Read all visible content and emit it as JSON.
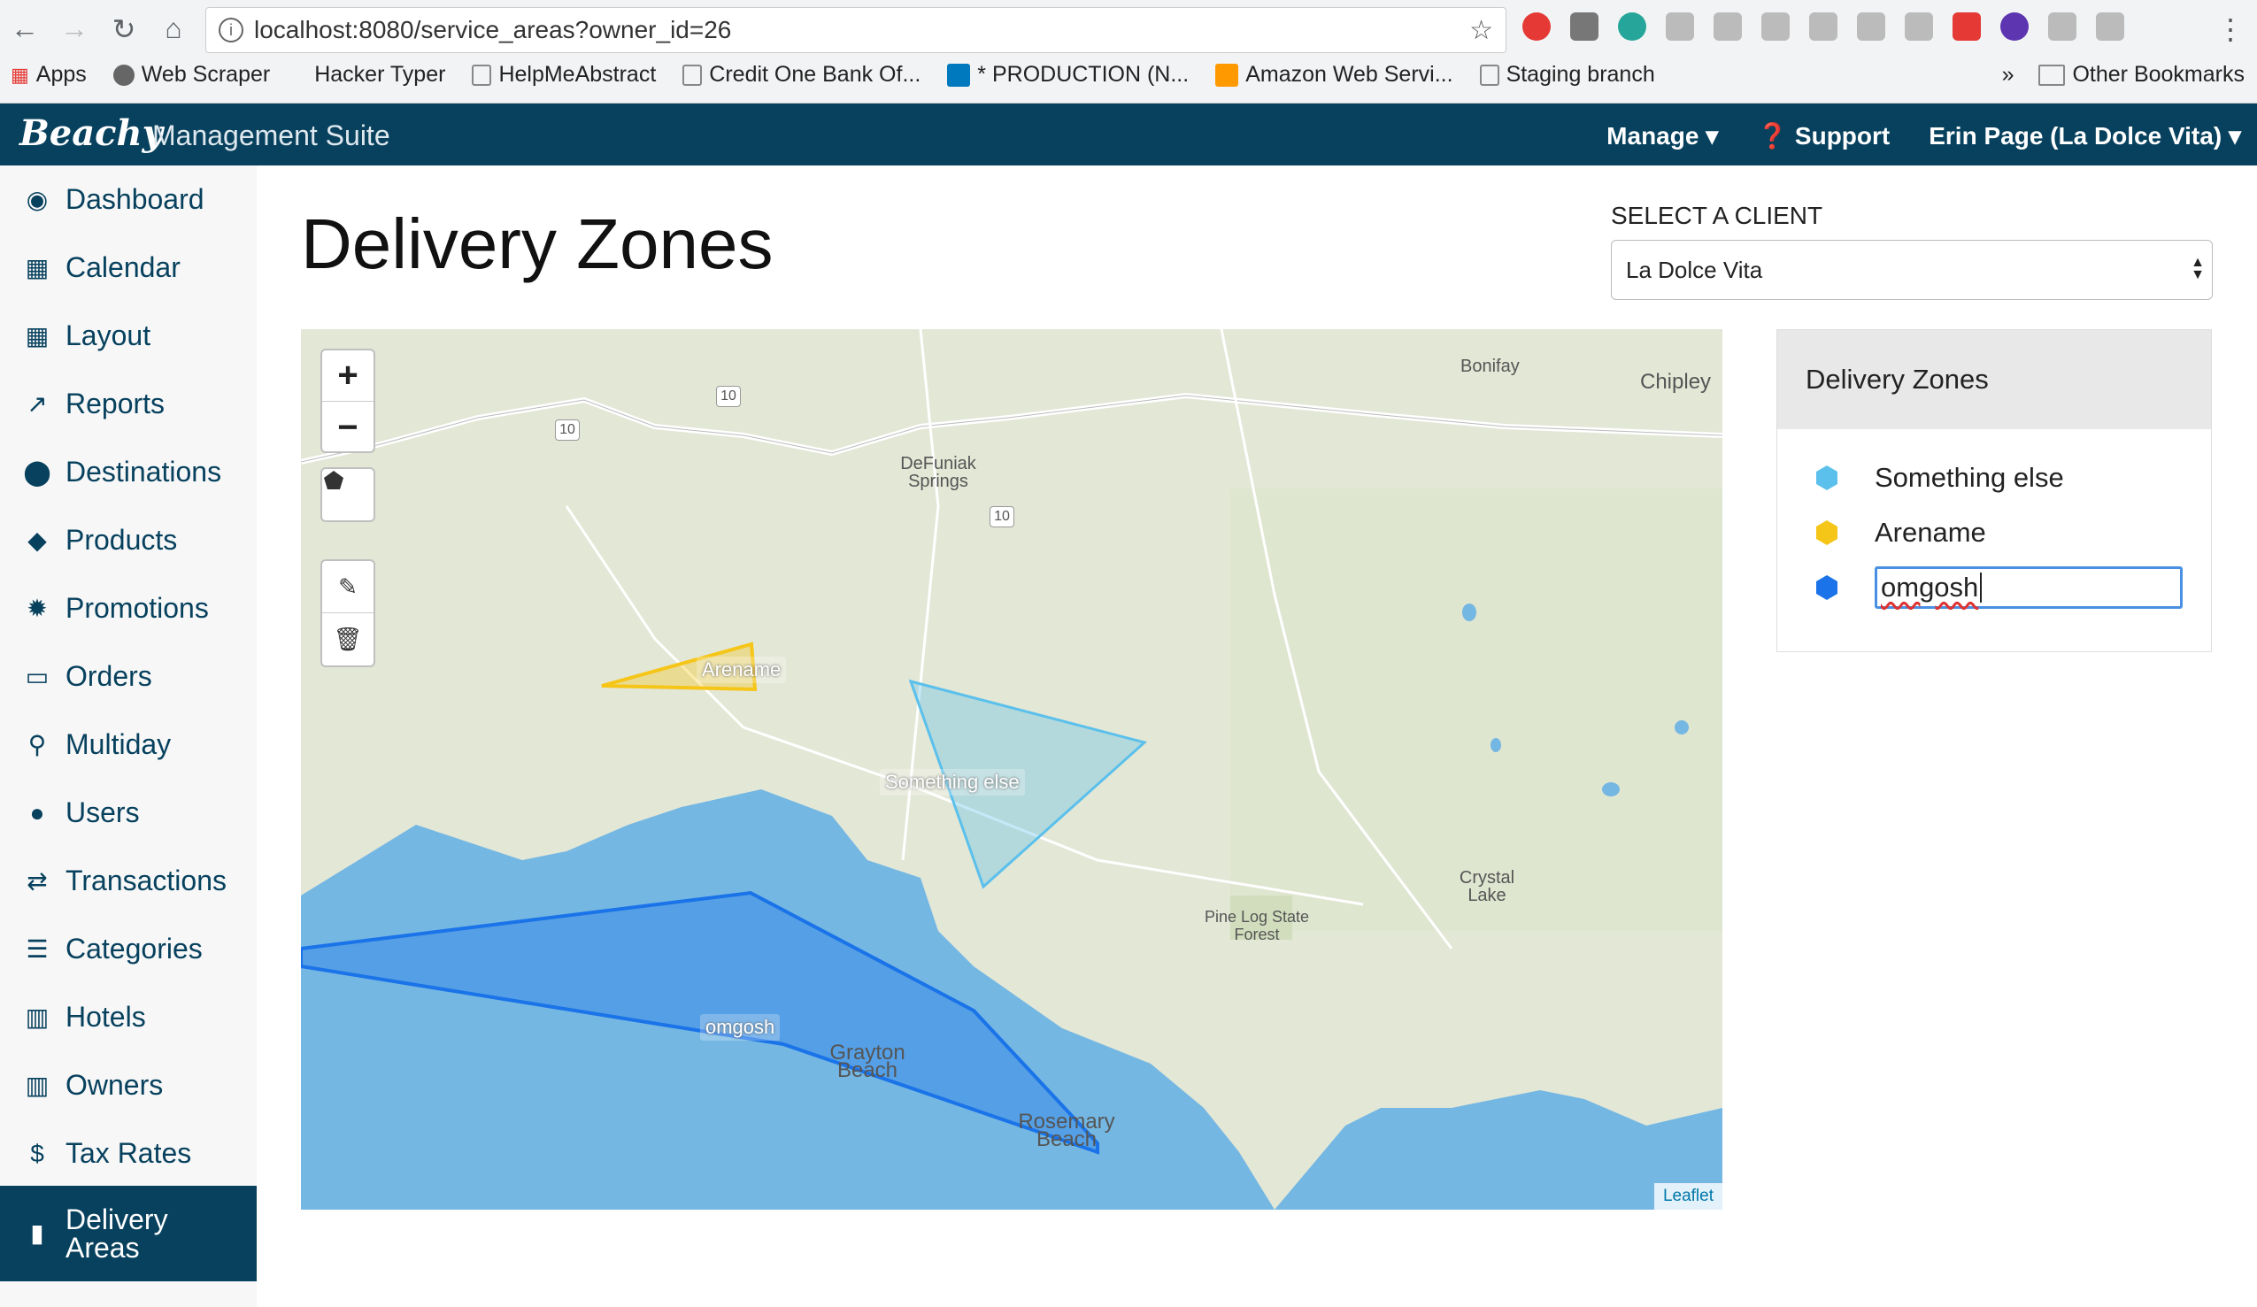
{
  "browser": {
    "url": "localhost:8080/service_areas?owner_id=26",
    "bookmarks": [
      "Apps",
      "Web Scraper",
      "Hacker Typer",
      "HelpMeAbstract",
      "Credit One Bank Of...",
      "* PRODUCTION (N...",
      "Amazon Web Servi...",
      "Staging branch"
    ],
    "other_bookmarks": "Other Bookmarks",
    "icons": [
      "back-icon",
      "forward-icon",
      "reload-icon",
      "home-icon",
      "info-icon",
      "star-icon",
      "menu-dots-icon"
    ]
  },
  "header": {
    "logo": "Beachy",
    "suite": "Management Suite",
    "manage": "Manage",
    "support": "Support",
    "user": "Erin Page (La Dolce Vita)"
  },
  "sidebar": {
    "items": [
      {
        "label": "Dashboard",
        "icon": "dashboard-icon"
      },
      {
        "label": "Calendar",
        "icon": "calendar-icon"
      },
      {
        "label": "Layout",
        "icon": "grid-icon"
      },
      {
        "label": "Reports",
        "icon": "chart-icon"
      },
      {
        "label": "Destinations",
        "icon": "map-pin-icon"
      },
      {
        "label": "Products",
        "icon": "tag-icon"
      },
      {
        "label": "Promotions",
        "icon": "badge-icon"
      },
      {
        "label": "Orders",
        "icon": "credit-card-icon"
      },
      {
        "label": "Multiday",
        "icon": "search-icon"
      },
      {
        "label": "Users",
        "icon": "user-icon"
      },
      {
        "label": "Transactions",
        "icon": "exchange-icon"
      },
      {
        "label": "Categories",
        "icon": "list-icon"
      },
      {
        "label": "Hotels",
        "icon": "building-icon"
      },
      {
        "label": "Owners",
        "icon": "building-icon"
      },
      {
        "label": "Tax Rates",
        "icon": "dollar-icon"
      }
    ],
    "active": {
      "line1": "Delivery",
      "line2": "Areas",
      "icon": "truck-icon"
    }
  },
  "main": {
    "title": "Delivery Zones",
    "client_label": "SELECT A CLIENT",
    "client_value": "La Dolce Vita"
  },
  "map": {
    "zone_labels": [
      "Arename",
      "Something else",
      "omgosh"
    ],
    "places": [
      "Bonifay",
      "Chipley",
      "DeFuniak Springs",
      "Crystal Lake",
      "Pine Log State Forest",
      "Grayton Beach",
      "Rosemary Beach"
    ],
    "highway": "10",
    "attribution": "Leaflet",
    "controls": {
      "zoom_in": "+",
      "zoom_out": "−"
    }
  },
  "panel": {
    "title": "Delivery Zones",
    "zones": [
      {
        "name": "Something else",
        "color": "#5bc0eb"
      },
      {
        "name": "Arename",
        "color": "#f5c518"
      },
      {
        "name": "omgosh",
        "color": "#1a73e8"
      }
    ]
  }
}
